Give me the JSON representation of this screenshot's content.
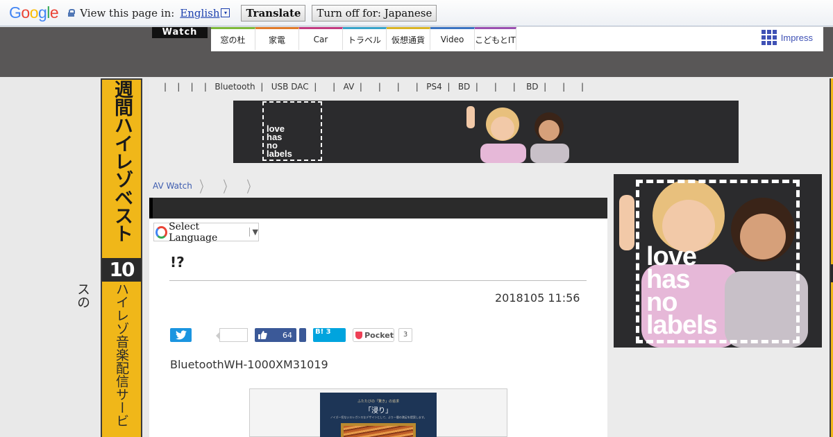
{
  "translate_bar": {
    "logo_text": "Google",
    "prompt": "View this page in:",
    "language": "English",
    "dropdown_glyph": "▾",
    "translate_button": "Translate",
    "turn_off_button": "Turn off for: Japanese"
  },
  "site_header": {
    "brand": "Watch",
    "nav_items": [
      "窓の杜",
      "家電",
      "Car",
      "トラベル",
      "仮想通貨",
      "Video",
      "こどもとIT"
    ],
    "nav_colors": [
      "#7db93a",
      "#e07b2a",
      "#c23a80",
      "#36a3c9",
      "#d9b425",
      "#3a73c2",
      "#9a4fb0"
    ],
    "impress_label": "Impress"
  },
  "left_banner": {
    "title": "週間ハイレゾベスト",
    "number": "10",
    "subtitle": "ハイレゾ音楽配信サービスの"
  },
  "topic_links": "|    |    |    |   Bluetooth  |   USB DAC  |      |   AV  |      |      |      |   PS4  |   BD  |      |      |    BD  |      |      |",
  "ad_text": [
    "love",
    "has",
    "no",
    "labels"
  ],
  "breadcrumb": {
    "home": "AV Watch",
    "chevron": "〉"
  },
  "select_language": {
    "label": "Select Language",
    "arrow": "▼"
  },
  "article": {
    "title": "!?",
    "date": "2018105 11:56",
    "social": {
      "fb_count": "64",
      "hatena_label": "B!",
      "hatena_count": "3",
      "pocket_label": "Pocket",
      "pocket_count": "3"
    },
    "lead": "BluetoothWH-1000XM31019",
    "figure_caption_small": "ふたたびの「驚き」の追求",
    "figure_heading": "「浸り」",
    "figure_caption_line": "ノイズ一切ないエレガンスなデザインとして、より一層の満足を提案します。"
  },
  "colors": {
    "header_bg": "#595757",
    "banner_yellow": "#f0b719",
    "link_blue": "#3d5caf",
    "twitter": "#1b95e0",
    "facebook": "#3b5998",
    "hatena": "#00a4de",
    "pocket": "#ee4056"
  }
}
